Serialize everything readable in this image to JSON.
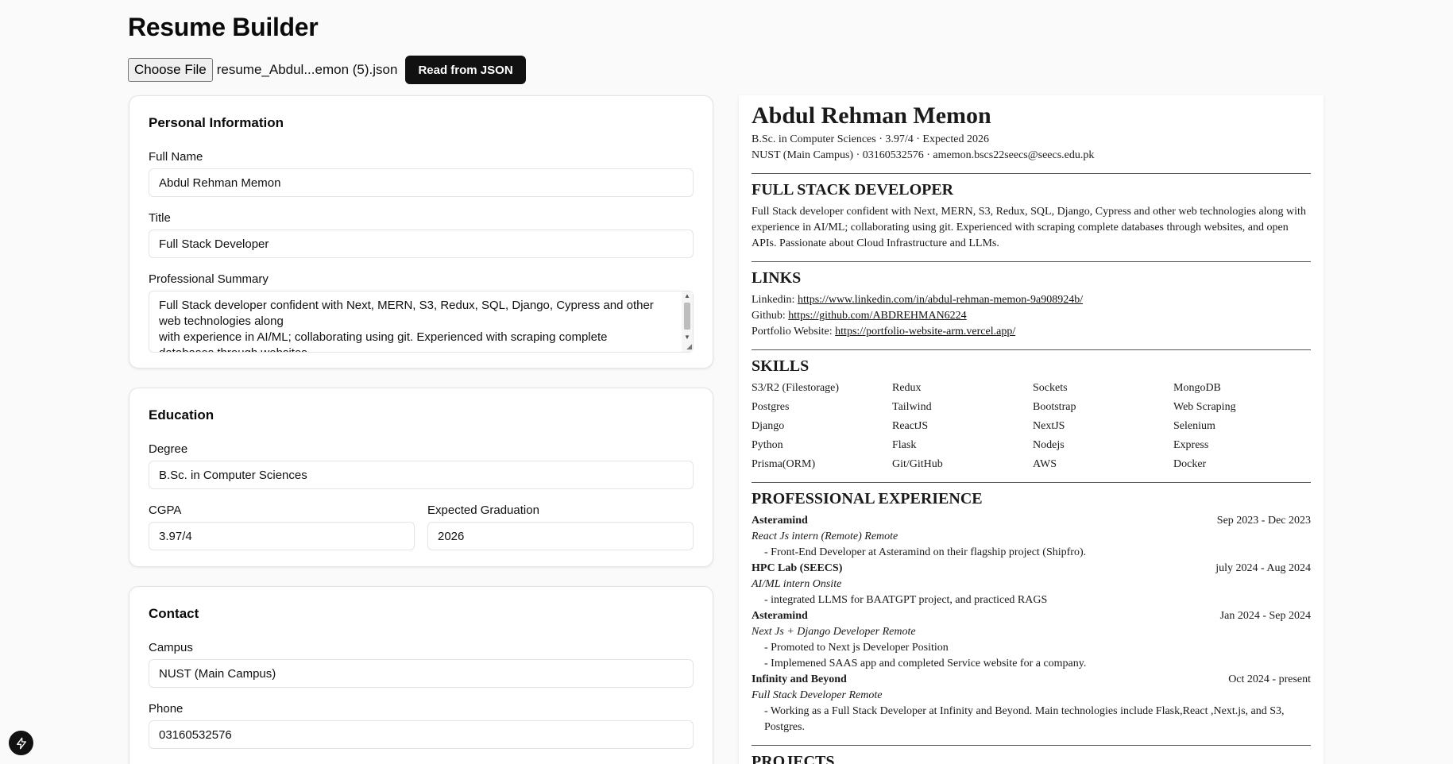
{
  "app": {
    "title": "Resume Builder"
  },
  "file": {
    "choose_label": "Choose File",
    "file_name": "resume_Abdul...emon (5).json",
    "read_label": "Read from JSON"
  },
  "personal": {
    "heading": "Personal Information",
    "full_name_label": "Full Name",
    "full_name": "Abdul Rehman Memon",
    "title_label": "Title",
    "title": "Full Stack Developer",
    "summary_label": "Professional Summary",
    "summary": "Full Stack developer confident with Next, MERN, S3, Redux, SQL, Django, Cypress and other web technologies along\nwith experience in AI/ML; collaborating using git. Experienced with scraping complete databases through websites"
  },
  "education": {
    "heading": "Education",
    "degree_label": "Degree",
    "degree": "B.Sc. in Computer Sciences",
    "cgpa_label": "CGPA",
    "cgpa": "3.97/4",
    "grad_label": "Expected Graduation",
    "grad": "2026"
  },
  "contact": {
    "heading": "Contact",
    "campus_label": "Campus",
    "campus": "NUST (Main Campus)",
    "phone_label": "Phone",
    "phone": "03160532576"
  },
  "preview": {
    "name": "Abdul Rehman Memon",
    "line1": "B.Sc. in Computer Sciences · 3.97/4 · Expected 2026",
    "line2": "NUST (Main Campus) · 03160532576 · amemon.bscs22seecs@seecs.edu.pk",
    "title": "FULL STACK DEVELOPER",
    "summary": "Full Stack developer confident with Next, MERN, S3, Redux, SQL, Django, Cypress and other web technologies along with experience in AI/ML; collaborating using git. Experienced with scraping complete databases through websites, and open APIs. Passionate about Cloud Infrastructure and LLMs.",
    "links_heading": "LINKS",
    "links": [
      {
        "label": "Linkedin: ",
        "url": "https://www.linkedin.com/in/abdul-rehman-memon-9a908924b/"
      },
      {
        "label": "Github: ",
        "url": "https://github.com/ABDREHMAN6224"
      },
      {
        "label": "Portfolio Website: ",
        "url": "https://portfolio-website-arm.vercel.app/"
      }
    ],
    "skills_heading": "SKILLS",
    "skills": [
      "S3/R2 (Filestorage)",
      "Redux",
      "Sockets",
      "MongoDB",
      "Postgres",
      "Tailwind",
      "Bootstrap",
      "Web Scraping",
      "Django",
      "ReactJS",
      "NextJS",
      "Selenium",
      "Python",
      "Flask",
      "Nodejs",
      "Express",
      "Prisma(ORM)",
      "Git/GitHub",
      "AWS",
      "Docker"
    ],
    "exp_heading": "PROFESSIONAL EXPERIENCE",
    "experience": [
      {
        "company": "Asteramind",
        "dates": "Sep 2023 - Dec 2023",
        "role": "React Js intern (Remote) Remote",
        "bullets": [
          "- Front-End Developer at Asteramind on their flagship project (Shipfro)."
        ]
      },
      {
        "company": "HPC Lab (SEECS)",
        "dates": "july 2024 - Aug 2024",
        "role": "AI/ML intern Onsite",
        "bullets": [
          "- integrated LLMS for BAATGPT project, and practiced RAGS"
        ]
      },
      {
        "company": "Asteramind",
        "dates": "Jan 2024 - Sep 2024",
        "role": "Next Js + Django Developer Remote",
        "bullets": [
          "- Promoted to Next js Developer Position",
          "- Implemened SAAS app and completed Service website for a company."
        ]
      },
      {
        "company": "Infinity and Beyond",
        "dates": "Oct 2024 - present",
        "role": "Full Stack Developer Remote",
        "bullets": [
          "- Working as a Full Stack Developer at Infinity and Beyond. Main technologies include Flask,React ,Next.js, and S3, Postgres."
        ]
      }
    ],
    "projects_heading": "PROJECTS"
  }
}
